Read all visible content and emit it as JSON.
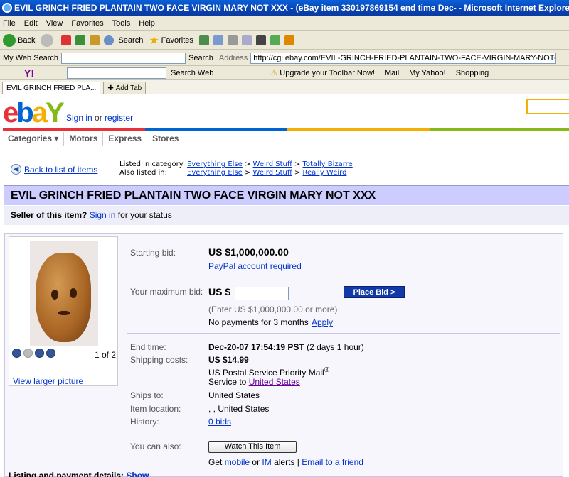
{
  "window": {
    "title": "EVIL GRINCH FRIED PLANTAIN TWO FACE VIRGIN MARY NOT XXX - (eBay item 330197869154 end time Dec- - Microsoft Internet Explorer"
  },
  "menu": [
    "File",
    "Edit",
    "View",
    "Favorites",
    "Tools",
    "Help"
  ],
  "toolbar": {
    "back": "Back",
    "search": "Search",
    "favorites": "Favorites"
  },
  "addressbar": {
    "web_search_label": "My Web Search",
    "search_btn": "Search",
    "address_label": "Address",
    "url": "http://cgi.ebay.com/EVIL-GRINCH-FRIED-PLANTAIN-TWO-FACE-VIRGIN-MARY-NOT-XXX_W"
  },
  "yahoo_bar": {
    "search_web": "Search Web",
    "upgrade": "Upgrade your Toolbar Now!",
    "mail": "Mail",
    "my_yahoo": "My Yahoo!",
    "shopping": "Shopping"
  },
  "tabs": {
    "active": "EVIL GRINCH FRIED PLA...",
    "add": "Add Tab"
  },
  "ebay": {
    "signin_link": "Sign in",
    "or_register": " or ",
    "register_link": "register",
    "nav": [
      "Categories ▾",
      "Motors",
      "Express",
      "Stores"
    ],
    "back_link": "Back to list of items",
    "listed_label": "Listed in category:",
    "also_label": "Also listed in:",
    "cat1": [
      "Everything Else",
      "Weird Stuff",
      "Totally Bizarre"
    ],
    "cat2": [
      "Everything Else",
      "Weird Stuff",
      "Really Weird"
    ],
    "item_title": "EVIL GRINCH FRIED PLANTAIN TWO FACE VIRGIN MARY NOT XXX",
    "seller_q": "Seller of this item?",
    "seller_signin": "Sign in",
    "seller_rest": "for your status",
    "pic_pager": "1 of 2",
    "view_larger": "View larger picture",
    "starting_bid_label": "Starting bid:",
    "starting_bid": "US $1,000,000.00",
    "paypal": "PayPal account required",
    "max_bid_label": "Your maximum bid:",
    "max_bid_prefix": "US $",
    "place_bid": "Place Bid >",
    "enter_hint": "(Enter US $1,000,000.00 or more)",
    "no_payments": "No payments for 3 months",
    "apply": "Apply",
    "end_time_label": "End time:",
    "end_time": "Dec-20-07 17:54:19 PST",
    "end_time_left": "(2 days 1 hour)",
    "shipping_label": "Shipping costs:",
    "shipping_cost": "US $14.99",
    "shipping_method": "US Postal Service Priority Mail",
    "service_to": "Service to",
    "service_country": "United States",
    "ships_to_label": "Ships to:",
    "ships_to": "United States",
    "location_label": "Item location:",
    "location": ", , United States",
    "history_label": "History:",
    "history": "0 bids",
    "also_label2": "You can also:",
    "watch": "Watch This Item",
    "get": "Get",
    "mobile": "mobile",
    "or": "or",
    "im": "IM",
    "alerts": "alerts |",
    "email": "Email to a friend",
    "listing_details": "Listing and payment details:",
    "show": "Show"
  }
}
